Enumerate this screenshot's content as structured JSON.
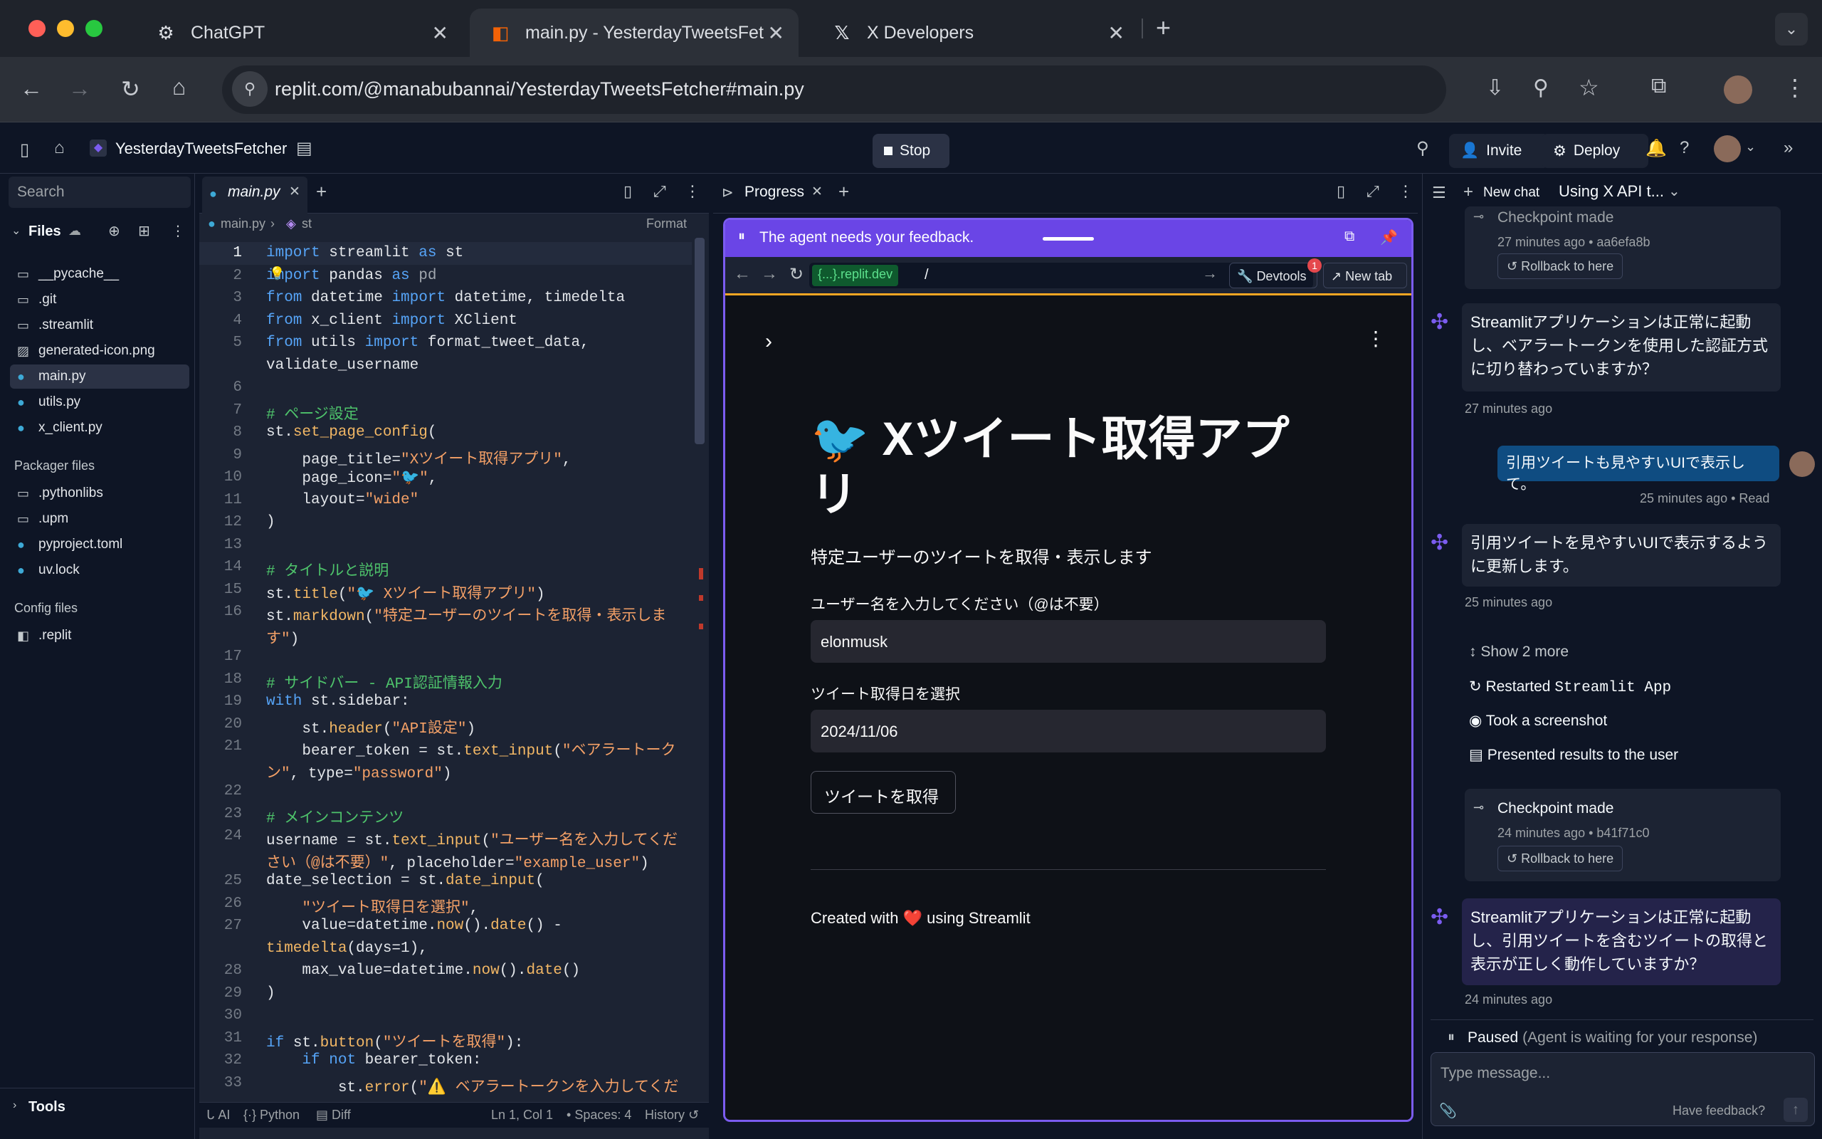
{
  "browser": {
    "tabs": [
      {
        "title": "ChatGPT",
        "icon": "chatgpt-icon"
      },
      {
        "title": "main.py - YesterdayTweetsFet",
        "icon": "replit-icon"
      },
      {
        "title": "X Developers",
        "icon": "x-logo-icon"
      }
    ],
    "url": "replit.com/@manabubannai/YesterdayTweetsFetcher#main.py"
  },
  "header": {
    "project": "YesterdayTweetsFetcher",
    "stop": "Stop",
    "invite": "Invite",
    "deploy": "Deploy"
  },
  "sidebar": {
    "search_placeholder": "Search",
    "files_label": "Files",
    "files": [
      {
        "name": "__pycache__",
        "icon": "folder-icon"
      },
      {
        "name": ".git",
        "icon": "folder-icon"
      },
      {
        "name": ".streamlit",
        "icon": "folder-icon"
      },
      {
        "name": "generated-icon.png",
        "icon": "image-icon"
      },
      {
        "name": "main.py",
        "icon": "python-icon"
      },
      {
        "name": "utils.py",
        "icon": "python-icon"
      },
      {
        "name": "x_client.py",
        "icon": "python-icon"
      }
    ],
    "packager_label": "Packager files",
    "packager_files": [
      {
        "name": ".pythonlibs",
        "icon": "folder-icon"
      },
      {
        "name": ".upm",
        "icon": "folder-icon"
      },
      {
        "name": "pyproject.toml",
        "icon": "python-icon"
      },
      {
        "name": "uv.lock",
        "icon": "python-icon"
      }
    ],
    "config_label": "Config files",
    "config_files": [
      {
        "name": ".replit",
        "icon": "replit-icon"
      }
    ],
    "tools": "Tools"
  },
  "editor": {
    "tab": "main.py",
    "crumb_file": "main.py",
    "crumb_symbol": "st",
    "format": "Format",
    "status": {
      "ai": "AI",
      "lang": "Python",
      "diff": "Diff",
      "pos": "Ln 1, Col 1",
      "spaces": "Spaces: 4",
      "history": "History"
    }
  },
  "progress": {
    "tab": "Progress",
    "feedback": "The agent needs your feedback.",
    "domain": "{...}.replit.dev",
    "path": "/",
    "devtools": "Devtools",
    "devtools_badge": "1",
    "newtab": "New tab",
    "app": {
      "title_line1": "🐦 Xツイート取得アプ",
      "title_line2": "リ",
      "subtitle": "特定ユーザーのツイートを取得・表示します",
      "username_label": "ユーザー名を入力してください（@は不要）",
      "username_value": "elonmusk",
      "date_label": "ツイート取得日を選択",
      "date_value": "2024/11/06",
      "button": "ツイートを取得",
      "footer_pre": "Created with",
      "footer_heart": "❤️",
      "footer_post": "using Streamlit"
    }
  },
  "chat": {
    "newchat": "New chat",
    "title": "Using X API t...",
    "cp1_title": "Checkpoint made",
    "cp1_meta": "27 minutes ago • aa6efa8b",
    "rollback": "Rollback to here",
    "msg1": "Streamlitアプリケーションは正常に起動し、ベアラートークンを使用した認証方式に切り替わっていますか？",
    "msg1_time": "27 minutes ago",
    "user_msg": "引用ツイートも見やすいUIで表示して。",
    "user_time": "25 minutes ago • Read",
    "msg2": "引用ツイートを見やすいUIで表示するように更新します。",
    "msg2_time": "25 minutes ago",
    "show_more": "Show 2 more",
    "step1_pre": "Restarted",
    "step1_code": "Streamlit App",
    "step2": "Took a screenshot",
    "step3": "Presented results to the user",
    "cp2_title": "Checkpoint made",
    "cp2_meta": "24 minutes ago • b41f71c0",
    "msg3": "Streamlitアプリケーションは正常に起動し、引用ツイートを含むツイートの取得と表示が正しく動作していますか？",
    "msg3_time": "24 minutes ago",
    "paused": "Paused",
    "paused_detail": "(Agent is waiting for your response)",
    "input_placeholder": "Type message...",
    "feedback": "Have feedback?"
  },
  "colors": {
    "accent": "#7b5cf0",
    "bg": "#0e1525",
    "panel": "#1c2333"
  }
}
